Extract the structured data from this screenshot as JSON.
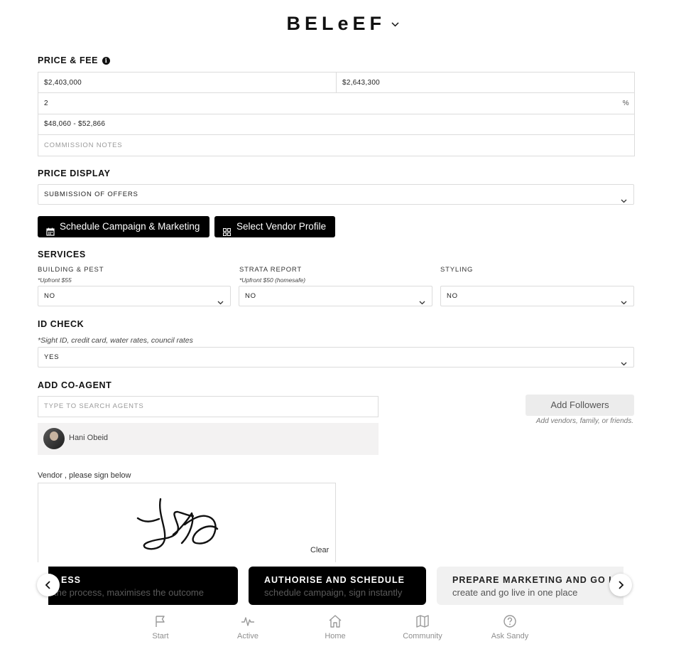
{
  "brand": {
    "name": "BELeEF"
  },
  "price_fee": {
    "title": "PRICE & FEE",
    "price_low": "$2,403,000",
    "price_high": "$2,643,300",
    "commission_rate": "2",
    "commission_unit": "%",
    "commission_range": "$48,060 - $52,866",
    "notes_placeholder": "COMMISSION NOTES"
  },
  "price_display": {
    "title": "PRICE DISPLAY",
    "selected": "SUBMISSION OF OFFERS"
  },
  "actions": {
    "schedule_label": "Schedule Campaign & Marketing",
    "vendor_label": "Select Vendor Profile"
  },
  "services": {
    "title": "SERVICES",
    "items": [
      {
        "label": "BUILDING & PEST",
        "note": "*Upfront $55",
        "value": "NO"
      },
      {
        "label": "STRATA REPORT",
        "note": "*Upfront $50 (homesafe)",
        "value": "NO"
      },
      {
        "label": "STYLING",
        "note": "",
        "value": "NO"
      }
    ]
  },
  "id_check": {
    "title": "ID CHECK",
    "note": "*Sight ID, credit card, water rates, council rates",
    "value": "YES"
  },
  "co_agent": {
    "title": "ADD CO-AGENT",
    "search_placeholder": "TYPE TO SEARCH AGENTS",
    "agents": [
      {
        "name": "Hani Obeid"
      }
    ],
    "followers_label": "Add Followers",
    "followers_note": "Add vendors, family, or friends."
  },
  "signature": {
    "label": "Vendor , please sign below",
    "clear_label": "Clear"
  },
  "carousel": {
    "cards": [
      {
        "title": "ESS",
        "subtitle": "the process, maximises the outcome",
        "style": "dark"
      },
      {
        "title": "AUTHORISE AND SCHEDULE",
        "subtitle": "schedule campaign, sign instantly",
        "style": "dark"
      },
      {
        "title": "PREPARE MARKETING AND GO LI",
        "subtitle": "create and go live in one place",
        "style": "light"
      }
    ]
  },
  "bottom_nav": {
    "items": [
      {
        "label": "Start",
        "icon": "flag-icon"
      },
      {
        "label": "Active",
        "icon": "activity-icon"
      },
      {
        "label": "Home",
        "icon": "home-icon"
      },
      {
        "label": "Community",
        "icon": "map-icon"
      },
      {
        "label": "Ask Sandy",
        "icon": "help-circle-icon"
      }
    ]
  },
  "colors": {
    "primary": "#000000",
    "border": "#dcdcdc",
    "muted": "#9a9a9a",
    "card_light": "#f1f1f1"
  }
}
